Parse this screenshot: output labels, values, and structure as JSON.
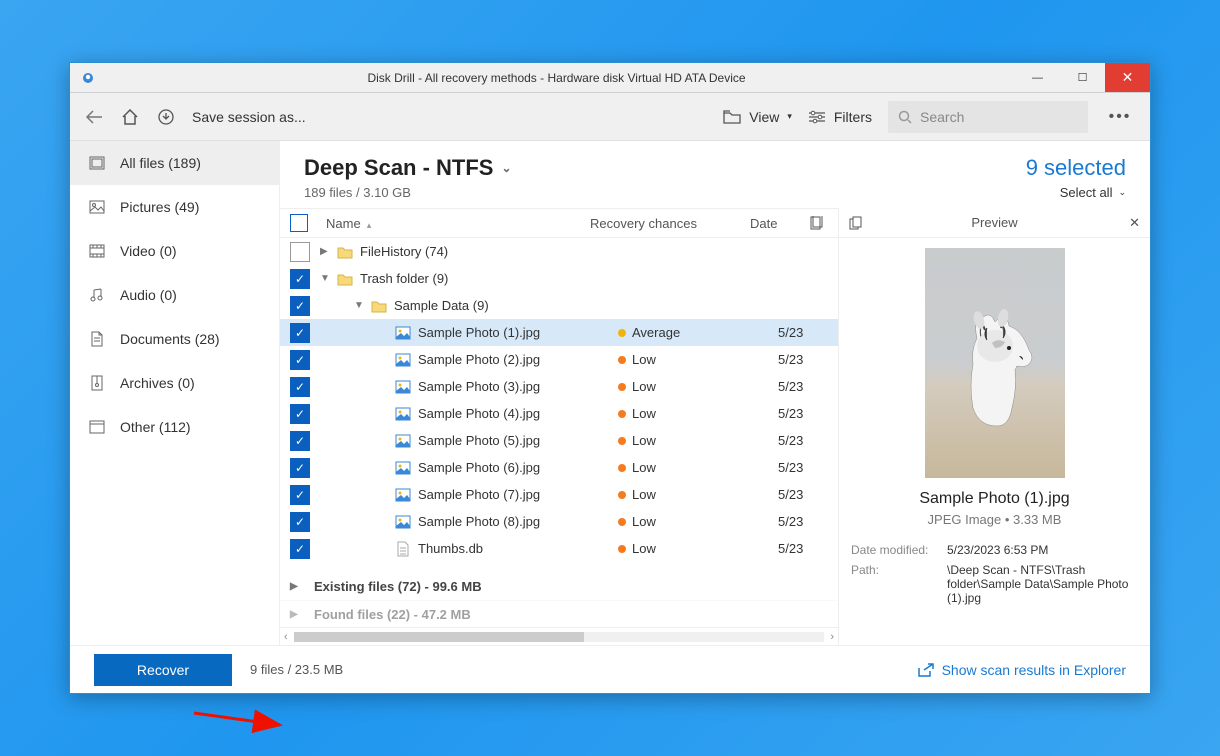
{
  "window": {
    "title": "Disk Drill - All recovery methods - Hardware disk Virtual HD ATA Device"
  },
  "toolbar": {
    "save_session": "Save session as...",
    "view": "View",
    "filters": "Filters",
    "search_placeholder": "Search"
  },
  "sidebar": {
    "items": [
      {
        "label": "All files (189)",
        "icon": "all"
      },
      {
        "label": "Pictures (49)",
        "icon": "picture"
      },
      {
        "label": "Video (0)",
        "icon": "video"
      },
      {
        "label": "Audio (0)",
        "icon": "audio"
      },
      {
        "label": "Documents (28)",
        "icon": "document"
      },
      {
        "label": "Archives (0)",
        "icon": "archive"
      },
      {
        "label": "Other (112)",
        "icon": "other"
      }
    ]
  },
  "header": {
    "title": "Deep Scan - NTFS",
    "subtitle": "189 files / 3.10 GB",
    "selected": "9 selected",
    "select_all": "Select all"
  },
  "columns": {
    "name": "Name",
    "recovery": "Recovery chances",
    "date": "Date"
  },
  "tree": {
    "rows": [
      {
        "type": "folder",
        "name": "FileHistory (74)",
        "level": 0,
        "checked": "none",
        "expanded": false
      },
      {
        "type": "folder",
        "name": "Trash folder (9)",
        "level": 0,
        "checked": "checked",
        "expanded": true
      },
      {
        "type": "folder",
        "name": "Sample Data (9)",
        "level": 1,
        "checked": "checked",
        "expanded": true
      },
      {
        "type": "file",
        "name": "Sample Photo (1).jpg",
        "level": 2,
        "checked": "checked",
        "recovery": "Average",
        "dot": "avg",
        "date": "5/23",
        "selected": true
      },
      {
        "type": "file",
        "name": "Sample Photo (2).jpg",
        "level": 2,
        "checked": "checked",
        "recovery": "Low",
        "dot": "low",
        "date": "5/23"
      },
      {
        "type": "file",
        "name": "Sample Photo (3).jpg",
        "level": 2,
        "checked": "checked",
        "recovery": "Low",
        "dot": "low",
        "date": "5/23"
      },
      {
        "type": "file",
        "name": "Sample Photo (4).jpg",
        "level": 2,
        "checked": "checked",
        "recovery": "Low",
        "dot": "low",
        "date": "5/23"
      },
      {
        "type": "file",
        "name": "Sample Photo (5).jpg",
        "level": 2,
        "checked": "checked",
        "recovery": "Low",
        "dot": "low",
        "date": "5/23"
      },
      {
        "type": "file",
        "name": "Sample Photo (6).jpg",
        "level": 2,
        "checked": "checked",
        "recovery": "Low",
        "dot": "low",
        "date": "5/23"
      },
      {
        "type": "file",
        "name": "Sample Photo (7).jpg",
        "level": 2,
        "checked": "checked",
        "recovery": "Low",
        "dot": "low",
        "date": "5/23"
      },
      {
        "type": "file",
        "name": "Sample Photo (8).jpg",
        "level": 2,
        "checked": "checked",
        "recovery": "Low",
        "dot": "low",
        "date": "5/23"
      },
      {
        "type": "file",
        "name": "Thumbs.db",
        "level": 2,
        "checked": "checked",
        "recovery": "Low",
        "dot": "low",
        "date": "5/23",
        "icon": "db"
      }
    ],
    "groups": [
      {
        "label": "Existing files (72) - 99.6 MB"
      },
      {
        "label": "Found files (22) - 47.2 MB"
      }
    ]
  },
  "preview": {
    "title": "Preview",
    "name": "Sample Photo (1).jpg",
    "type_size": "JPEG Image • 3.33 MB",
    "date_modified_label": "Date modified:",
    "date_modified": "5/23/2023 6:53 PM",
    "path_label": "Path:",
    "path": "\\Deep Scan - NTFS\\Trash folder\\Sample Data\\Sample Photo (1).jpg"
  },
  "footer": {
    "recover": "Recover",
    "info": "9 files / 23.5 MB",
    "explorer": "Show scan results in Explorer"
  }
}
